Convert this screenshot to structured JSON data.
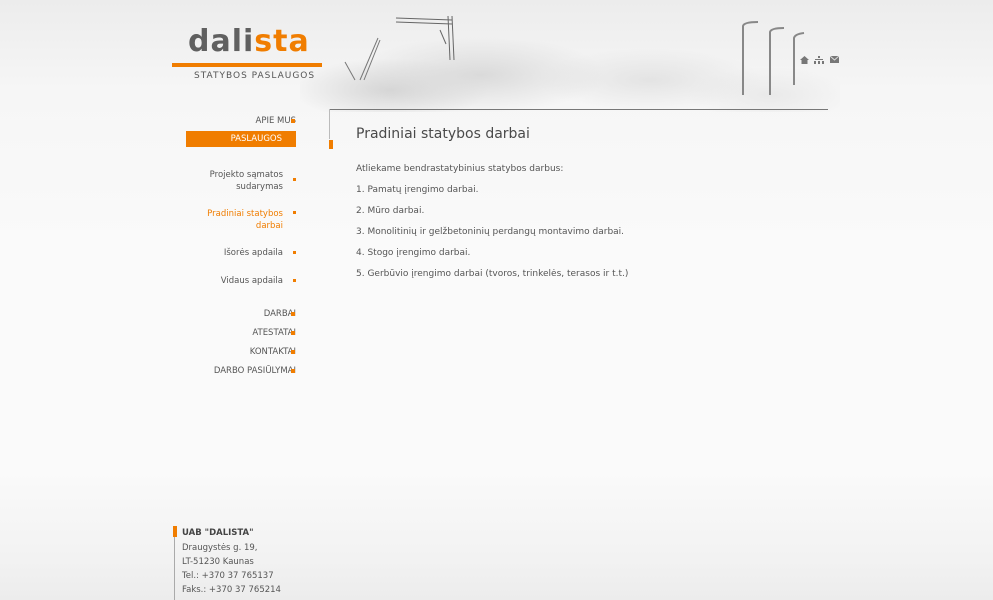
{
  "brand": {
    "logo_part1": "dali",
    "logo_part2": "sta",
    "tagline": "STATYBOS PASLAUGOS"
  },
  "top_icons": [
    "home-icon",
    "sitemap-icon",
    "mail-icon"
  ],
  "nav": {
    "apie_mus": "APIE MUS",
    "paslaugos": "PASLAUGOS",
    "sub": [
      {
        "line1": "Projekto sąmatos",
        "line2": "sudarymas"
      },
      {
        "line1": "Pradiniai statybos",
        "line2": "darbai"
      },
      {
        "line1": "Išorės apdaila",
        "line2": ""
      },
      {
        "line1": "Vidaus apdaila",
        "line2": ""
      }
    ],
    "darbai": "DARBAI",
    "atestatai": "ATESTATAI",
    "kontaktai": "KONTAKTAI",
    "darbo_pasiulymai": "DARBO PASIŪLYMAI"
  },
  "content": {
    "title": "Pradiniai statybos darbai",
    "intro": "Atliekame bendrastatybinius statybos darbus:",
    "items": [
      "1. Pamatų įrengimo darbai.",
      "2. Mūro darbai.",
      "3. Monolitinių ir gelžbetoninių perdangų montavimo darbai.",
      "4. Stogo įrengimo darbai.",
      "5. Gerbūvio įrengimo darbai (tvoros, trinkelės, terasos ir t.t.)"
    ]
  },
  "footer": {
    "company": "UAB \"DALISTA\"",
    "street": "Draugystės g. 19,",
    "city": "LT-51230 Kaunas",
    "tel": "Tel.: +370 37 765137",
    "fax": "Faks.: +370 37 765214"
  },
  "colors": {
    "accent": "#f07d00",
    "text": "#555555"
  }
}
